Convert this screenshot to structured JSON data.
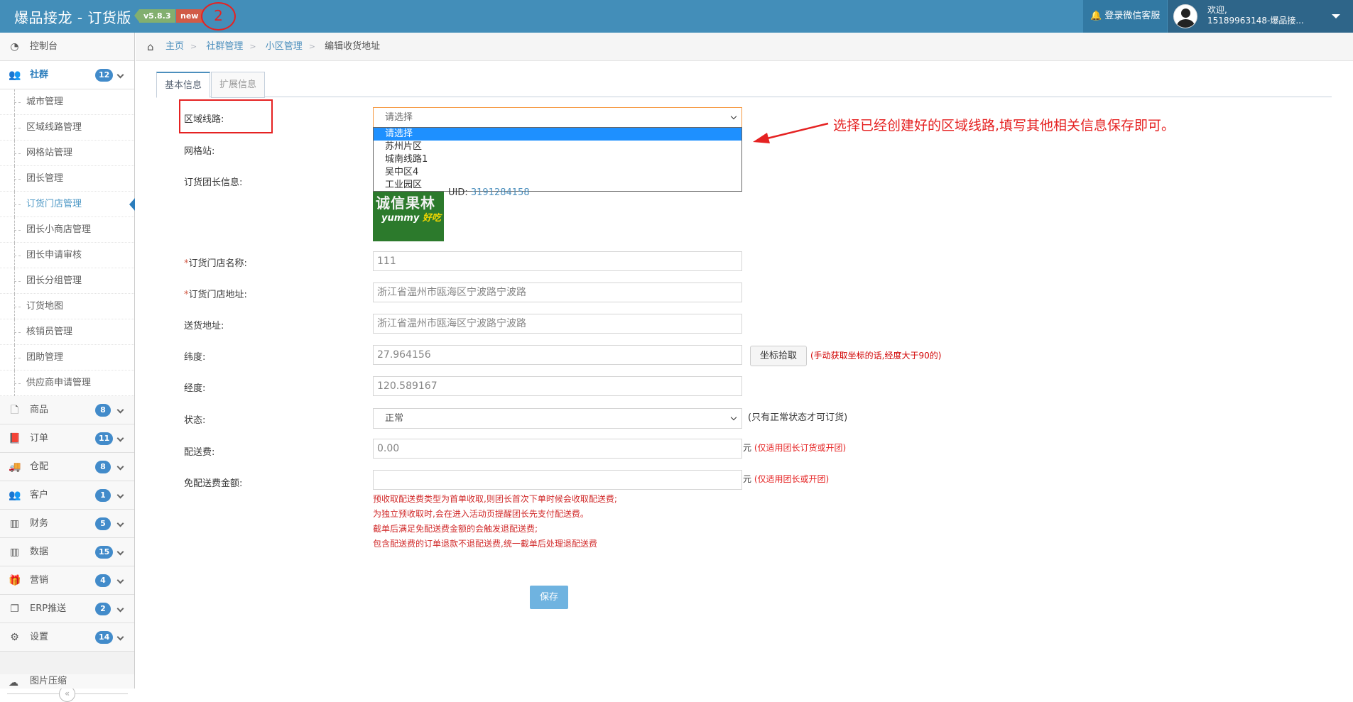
{
  "header": {
    "brand": "爆品接龙 - 订货版",
    "version": "v5.8.3",
    "new_badge": "new",
    "step_marker": "2",
    "wechat_service": "登录微信客服",
    "welcome": "欢迎,",
    "user": "15189963148-爆品接...",
    "accent": "#438eb9"
  },
  "sidebar": {
    "dashboard": "控制台",
    "shequn": {
      "label": "社群",
      "badge": "12"
    },
    "sub_items": [
      "城市管理",
      "区域线路管理",
      "网格站管理",
      "团长管理",
      "订货门店管理",
      "团长小商店管理",
      "团长申请审核",
      "团长分组管理",
      "订货地图",
      "核销员管理",
      "团助管理",
      "供应商申请管理"
    ],
    "active_sub": "订货门店管理",
    "groups": [
      {
        "label": "商品",
        "badge": "8",
        "icon": "file-icon"
      },
      {
        "label": "订单",
        "badge": "11",
        "icon": "book-icon"
      },
      {
        "label": "仓配",
        "badge": "8",
        "icon": "truck-icon"
      },
      {
        "label": "客户",
        "badge": "1",
        "icon": "users-icon"
      },
      {
        "label": "财务",
        "badge": "5",
        "icon": "chart-icon"
      },
      {
        "label": "数据",
        "badge": "15",
        "icon": "chart-icon"
      },
      {
        "label": "营销",
        "badge": "4",
        "icon": "gift-icon"
      },
      {
        "label": "ERP推送",
        "badge": "2",
        "icon": "copy-icon"
      },
      {
        "label": "设置",
        "badge": "14",
        "icon": "cogs-icon"
      }
    ],
    "collapse": "«",
    "bottom_item": "图片压缩"
  },
  "breadcrumb": {
    "home": "主页",
    "items": [
      "社群管理",
      "小区管理"
    ],
    "current": "编辑收货地址"
  },
  "tabs": {
    "basic": "基本信息",
    "ext": "扩展信息"
  },
  "form": {
    "route_label": "区域线路:",
    "route_selected": "请选择",
    "route_options": [
      "请选择",
      "苏州片区",
      "城南线路1",
      "吴中区4",
      "工业园区"
    ],
    "grid_label": "网格站:",
    "leader_label": "订货团长信息:",
    "uid_label": "UID:",
    "uid_value": "3191284158",
    "thumb_text1": "诚信果林",
    "thumb_text2": "yummy",
    "thumb_text3": "好吃",
    "store_name_label": "订货门店名称:",
    "store_name": "111",
    "store_addr_label": "订货门店地址:",
    "store_addr": "浙江省温州市瓯海区宁波路宁波路",
    "delivery_addr_label": "送货地址:",
    "delivery_addr": "浙江省温州市瓯海区宁波路宁波路",
    "lat_label": "纬度:",
    "lat": "27.964156",
    "coord_btn": "坐标拾取",
    "coord_note": "(手动获取坐标的话,经度大于90的)",
    "lng_label": "经度:",
    "lng": "120.589167",
    "status_label": "状态:",
    "status_value": "正常",
    "status_note": "(只有正常状态才可订货)",
    "fee_label": "配送费:",
    "fee": "0.00",
    "yuan": "元",
    "fee_note": "(仅适用团长订货或开团)",
    "free_label": "免配送费金额:",
    "free": "",
    "free_note": "(仅适用团长或开团)",
    "warnings": [
      "预收取配送费类型为首单收取,则团长首次下单时候会收取配送费;",
      "为独立预收取时,会在进入活动页提醒团长先支付配送费。",
      "截单后满足免配送费金额的会触发退配送费;",
      "包含配送费的订单退款不退配送费,统一截单后处理退配送费"
    ],
    "save": "保存"
  },
  "annotation": "选择已经创建好的区域线路,填写其他相关信息保存即可。"
}
